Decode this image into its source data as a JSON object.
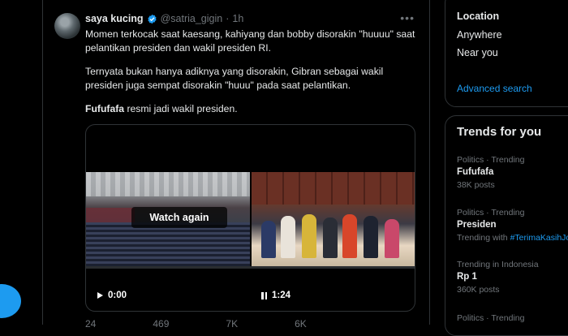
{
  "tweet": {
    "display_name": "saya kucing",
    "handle": "@satria_gigin",
    "separator": "·",
    "time": "1h",
    "para1": "Momen terkocak saat kaesang, kahiyang dan bobby disorakin \"huuuu\" saat pelantikan presiden dan wakil presiden RI.",
    "para2": "Ternyata bukan hanya adiknya yang disorakin, Gibran sebagai wakil presiden juga sempat disorakin \"huuu\" pada saat pelantikan.",
    "para3_bold": "Fufufafa",
    "para3_rest": " resmi jadi wakil presiden.",
    "media": {
      "overlay_label": "Watch again",
      "time_left": "0:00",
      "time_right": "1:24"
    },
    "actions": [
      "24",
      "469",
      "7K",
      "6K"
    ]
  },
  "search_filters": {
    "location_title": "Location",
    "options": [
      "Anywhere",
      "Near you"
    ],
    "advanced_link": "Advanced search"
  },
  "trends": {
    "title": "Trends for you",
    "items": [
      {
        "meta": "Politics · Trending",
        "name": "Fufufafa",
        "posts": "38K posts"
      },
      {
        "meta": "Politics · Trending",
        "name": "Presiden",
        "sub_prefix": "Trending with ",
        "sub_link": "#TerimaKasihJokowi"
      },
      {
        "meta": "Trending in Indonesia",
        "name": "Rp 1",
        "posts": "360K posts"
      },
      {
        "meta": "Politics · Trending",
        "name": "",
        "posts": ""
      }
    ]
  },
  "colors": {
    "accent": "#1d9bf0",
    "background": "#000000",
    "border": "#2f3336",
    "muted": "#71767b"
  }
}
